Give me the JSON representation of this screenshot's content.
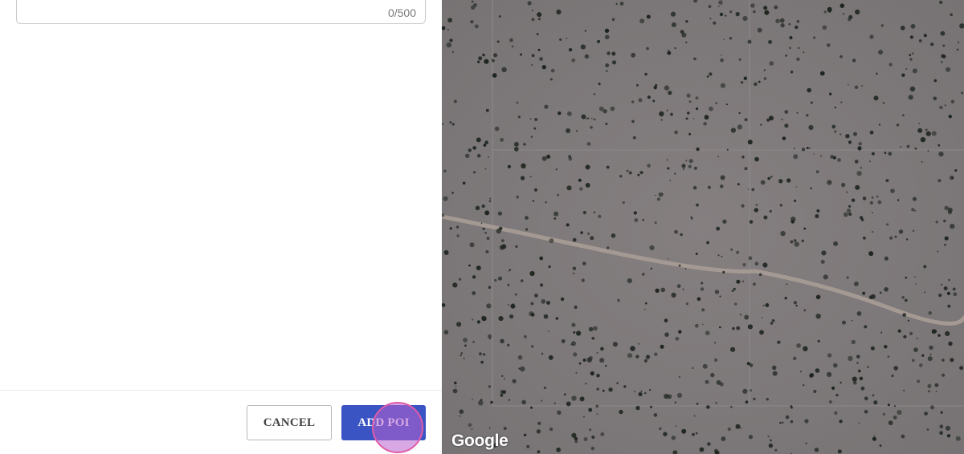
{
  "form": {
    "char_counter": "0/500",
    "cancel_label": "CANCEL",
    "add_label": "ADD POI"
  },
  "map": {
    "attribution": "Google",
    "imagery": "satellite"
  },
  "colors": {
    "primary": "#3a55c3",
    "click_indicator": "#e05ca8"
  }
}
